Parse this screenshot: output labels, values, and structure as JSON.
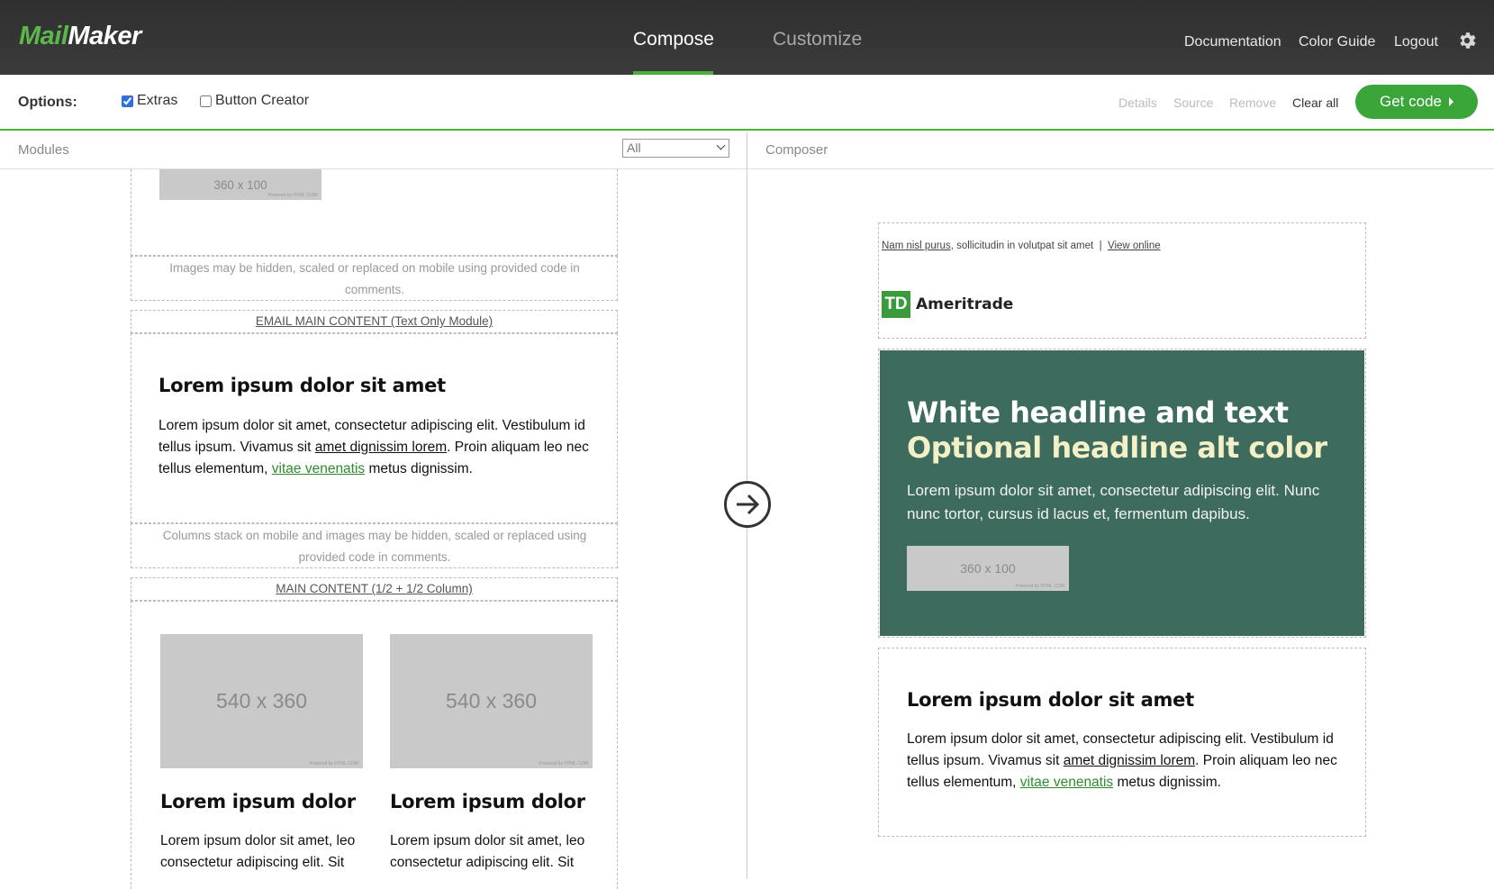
{
  "app": {
    "logo_part1": "Mail",
    "logo_part2": "Maker"
  },
  "nav": {
    "tabs": [
      {
        "label": "Compose",
        "active": true
      },
      {
        "label": "Customize",
        "active": false
      }
    ],
    "links": [
      "Documentation",
      "Color Guide",
      "Logout"
    ],
    "settings_icon": "gear-icon"
  },
  "options": {
    "label": "Options:",
    "extras": {
      "label": "Extras",
      "checked": true
    },
    "button_creator": {
      "label": "Button Creator",
      "checked": false
    },
    "actions": [
      "Details",
      "Source",
      "Remove",
      "Clear all"
    ],
    "get_code": "Get code"
  },
  "modules_panel": {
    "title": "Modules",
    "filter_value": "All",
    "top_image": "360 x 100",
    "note1": "Images may be hidden, scaled or replaced on mobile using provided code in comments.",
    "text_module": {
      "title": "EMAIL MAIN CONTENT (Text Only Module)",
      "heading": "Lorem ipsum dolor sit amet",
      "body_1": "Lorem ipsum dolor sit amet, consectetur adipiscing elit. Vestibulum id tellus ipsum. Vivamus sit ",
      "link_1": "amet dignissim lorem",
      "body_2": ". Proin aliquam leo nec tellus elementum, ",
      "link_2": "vitae venenatis",
      "body_3": " metus dignissim."
    },
    "note2": "Columns stack on mobile and images may be hidden, scaled or replaced using provided code in comments.",
    "column_module": {
      "title": "MAIN CONTENT (1/2 + 1/2 Column)",
      "image": "540 x 360",
      "heading": "Lorem ipsum dolor",
      "body_line1": "Lorem ipsum dolor sit amet, leo",
      "body_line2": "consectetur adipiscing elit. Sit"
    }
  },
  "composer_panel": {
    "title": "Composer",
    "preheader_link": "Nam nisl purus",
    "preheader_text": ", sollicitudin in volutpat sit amet  |  ",
    "view_online": "View online",
    "logo_mark": "TD",
    "logo_name": "Ameritrade",
    "hero": {
      "headline": "White headline and text",
      "alt_headline": "Optional headline alt color",
      "body": "Lorem ipsum dolor sit amet, consectetur adipiscing elit. Nunc nunc tortor, cursus id lacus et, fermentum dapibus.",
      "image": "360 x 100",
      "bg_color": "#3d6b5d"
    },
    "text_module": {
      "heading": "Lorem ipsum dolor sit amet",
      "body_1": "Lorem ipsum dolor sit amet, consectetur adipiscing elit. Vestibulum id tellus ipsum. Vivamus sit ",
      "link_1": "amet dignissim lorem",
      "body_2": ". Proin aliquam leo nec tellus elementum, ",
      "link_2": "vitae venenatis",
      "body_3": " metus dignissim."
    }
  },
  "colors": {
    "accent": "#4caf3b",
    "topbar": "#333333",
    "link_green": "#2e8b2e"
  }
}
